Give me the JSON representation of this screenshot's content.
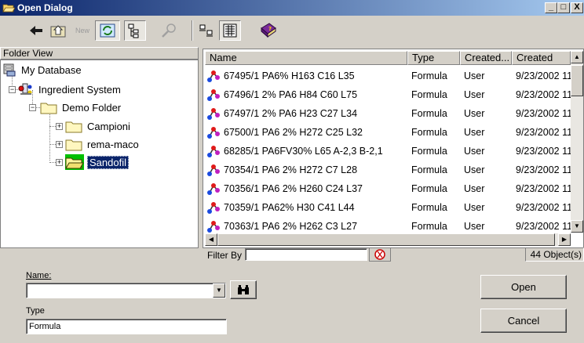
{
  "window": {
    "title": "Open Dialog"
  },
  "caption_buttons": {
    "minimize": "_",
    "maximize": "□",
    "close": "X"
  },
  "toolbar": {
    "new_label": "New"
  },
  "folder_view": {
    "header": "Folder View",
    "items": [
      {
        "label": "My Database"
      },
      {
        "label": "Ingredient System"
      },
      {
        "label": "Demo Folder"
      },
      {
        "label": "Campioni"
      },
      {
        "label": "rema-maco"
      },
      {
        "label": "Sandofil"
      }
    ]
  },
  "list": {
    "columns": [
      "Name",
      "Type",
      "Created...",
      "Created"
    ],
    "rows": [
      {
        "name": "67495/1 PA6%  H163 C16 L35",
        "type": "Formula",
        "created_by": "User",
        "created": "9/23/2002 11"
      },
      {
        "name": "67496/1  2% PA6 H84 C60 L75",
        "type": "Formula",
        "created_by": "User",
        "created": "9/23/2002 11"
      },
      {
        "name": "67497/1 2% PA6  H23 C27 L34",
        "type": "Formula",
        "created_by": "User",
        "created": "9/23/2002 11"
      },
      {
        "name": "67500/1 PA6 2%  H272 C25 L32",
        "type": "Formula",
        "created_by": "User",
        "created": "9/23/2002 11"
      },
      {
        "name": "68285/1 PA6FV30% L65 A-2,3 B-2,1",
        "type": "Formula",
        "created_by": "User",
        "created": "9/23/2002 11"
      },
      {
        "name": "70354/1 PA6 2%  H272 C7 L28",
        "type": "Formula",
        "created_by": "User",
        "created": "9/23/2002 11"
      },
      {
        "name": "70356/1 PA6 2%  H260 C24 L37",
        "type": "Formula",
        "created_by": "User",
        "created": "9/23/2002 11"
      },
      {
        "name": "70359/1 PA62%  H30 C41 L44",
        "type": "Formula",
        "created_by": "User",
        "created": "9/23/2002 11"
      },
      {
        "name": "70363/1 PA6 2% H262 C3 L27",
        "type": "Formula",
        "created_by": "User",
        "created": "9/23/2002 11"
      }
    ]
  },
  "filter": {
    "label": "Filter By",
    "value": ""
  },
  "status": {
    "object_count": "44 Object(s)"
  },
  "form": {
    "name_label": "Name:",
    "name_value": "",
    "type_label": "Type",
    "type_value": "Formula"
  },
  "buttons": {
    "open": "Open",
    "cancel": "Cancel"
  },
  "colors": {
    "title_start": "#0a246a",
    "title_end": "#a6caf0",
    "selection": "#0a246a",
    "face": "#d4d0c8"
  }
}
